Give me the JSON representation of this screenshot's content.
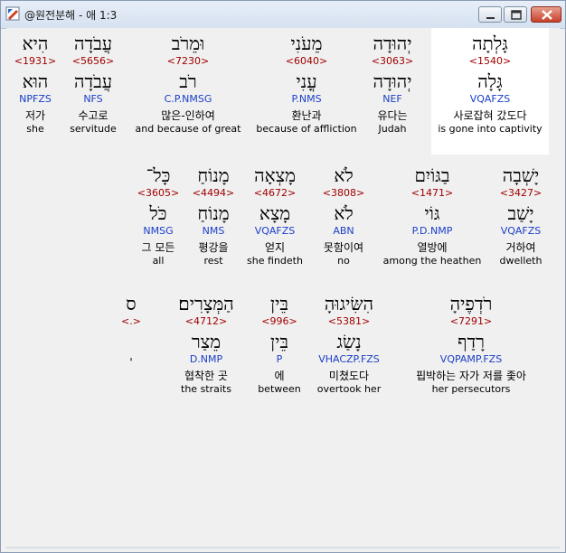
{
  "window": {
    "title": "@원전분해 - 애 1:3",
    "colors": {
      "strong": "#a00000",
      "parse": "#1a3ec8"
    }
  },
  "rows": [
    [
      {
        "heb": "גָּלְתָה",
        "strong": "<1540>",
        "lemma": "גָּלָה",
        "parse": "VQAFZS",
        "kor": "사로잡혀 갔도다",
        "eng": "is gone into captivity",
        "selected": true
      },
      {
        "heb": "יְהוּדָה",
        "strong": "<3063>",
        "lemma": "יְהוּדָה",
        "parse": "NEF",
        "kor": "유다는",
        "eng": "Judah"
      },
      {
        "heb": "מֵעֹנִי",
        "strong": "<6040>",
        "lemma": "עֳנִי",
        "parse": "P.NMS",
        "kor": "환난과",
        "eng": "because of affliction"
      },
      {
        "heb": "וּמֵרֹב",
        "strong": "<7230>",
        "lemma": "רֹב",
        "parse": "C.P.NMSG",
        "kor": "많은-인하여",
        "eng": "and because of great"
      },
      {
        "heb": "עֲבֹדָה",
        "strong": "<5656>",
        "lemma": "עֲבֹדָה",
        "parse": "NFS",
        "kor": "수고로",
        "eng": "servitude"
      },
      {
        "heb": "הִיא",
        "strong": "<1931>",
        "lemma": "הוּא",
        "parse": "NPFZS",
        "kor": "저가",
        "eng": "she"
      }
    ],
    [
      {
        "heb": "יָשְׁבָה",
        "strong": "<3427>",
        "lemma": "יָשַׁב",
        "parse": "VQAFZS",
        "kor": "거하여",
        "eng": "dwelleth"
      },
      {
        "heb": "בַגּוֹיִם",
        "strong": "<1471>",
        "lemma": "גּוֹי",
        "parse": "P.D.NMP",
        "kor": "열방에",
        "eng": "among the heathen"
      },
      {
        "heb": "לֹא",
        "strong": "<3808>",
        "lemma": "לֹא",
        "parse": "ABN",
        "kor": "못함이여",
        "eng": "no"
      },
      {
        "heb": "מָצְאָה",
        "strong": "<4672>",
        "lemma": "מָצָא",
        "parse": "VQAFZS",
        "kor": "얻지",
        "eng": "she findeth"
      },
      {
        "heb": "מָנוֹחַ",
        "strong": "<4494>",
        "lemma": "מָנוֹחַ",
        "parse": "NMS",
        "kor": "평강을",
        "eng": "rest"
      },
      {
        "heb": "כָּל־",
        "strong": "<3605>",
        "lemma": "כֹּל",
        "parse": "NMSG",
        "kor": "그 모든",
        "eng": "all"
      }
    ],
    [
      {
        "heb": "רֹדְפֶיהָ",
        "strong": "<7291>",
        "lemma": "רָדַף",
        "parse": "VQPAMP.FZS",
        "kor": "핍박하는 자가 저를 좇아",
        "eng": "her persecutors"
      },
      {
        "heb": "הִשִּׂיגוּהָ",
        "strong": "<5381>",
        "lemma": "נָשַׂג",
        "parse": "VHACZP.FZS",
        "kor": "미쳤도다",
        "eng": "overtook her"
      },
      {
        "heb": "בֵּין",
        "strong": "<996>",
        "lemma": "בֵּין",
        "parse": "P",
        "kor": "에",
        "eng": "between"
      },
      {
        "heb": "הַמְּצָרִים׃",
        "strong": "<4712>",
        "lemma": "מֵצַר",
        "parse": "D.NMP",
        "kor": "협착한 곳",
        "eng": "the straits"
      },
      {
        "heb": "ס",
        "strong": "<.>",
        "lemma": "",
        "parse": "",
        "kor": "'",
        "eng": ""
      }
    ]
  ]
}
